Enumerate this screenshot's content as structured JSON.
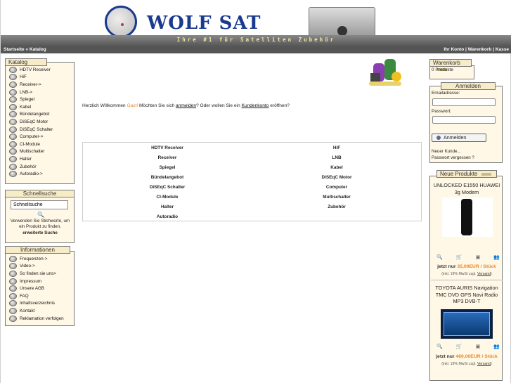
{
  "header": {
    "logo_text": "WOLF  SAT",
    "tagline": "Ihre #1 für Satelliten Zubehör"
  },
  "nav": {
    "breadcrumb": [
      "Startseite",
      "Katalog"
    ],
    "breadcrumb_sep": "»",
    "right_links": [
      "Ihr Konto",
      "Warenkorb",
      "Kasse"
    ],
    "right_sep": "|"
  },
  "catalog": {
    "title": "Katalog",
    "items": [
      "HDTV Receiver",
      "HiF",
      "Receiver->",
      "LNB->",
      "Spiegel",
      "Kabel",
      "Bündelangebot",
      "DiSEqC Motor",
      "DiSEqC Schalter",
      "Computer->",
      "CI-Module",
      "Multischalter",
      "Halter",
      "Zubehör",
      "Autoradio->"
    ]
  },
  "quicksearch": {
    "title": "Schnellsuche",
    "input_value": "Schnellsuche",
    "hint": "Verwenden Sie Stichworte, um ein Produkt zu finden.",
    "advanced": "erweiterte Suche"
  },
  "info": {
    "title": "Informationen",
    "items": [
      "Frequenzen->",
      "Video->",
      "So finden sie uns>",
      "Impressum",
      "Unsere AGB",
      "FAQ",
      "Inhaltsverzeichnis",
      "Kontakt",
      "Reklamation verfolgen"
    ]
  },
  "welcome": {
    "pre": "Herzlich Willkommen ",
    "guest": "Gast!",
    "mid": " Möchten Sie sich ",
    "login_link": "anmelden",
    "mid2": "? Oder wollen Sie ein ",
    "account_link": "Kundenkonto",
    "post": " eröffnen?"
  },
  "categories": [
    [
      "HDTV Receiver",
      "HiF"
    ],
    [
      "Receiver",
      "LNB"
    ],
    [
      "Spiegel",
      "Kabel"
    ],
    [
      "Bündelangebot",
      "DiSEqC Motor"
    ],
    [
      "DiSEqC Schalter",
      "Computer"
    ],
    [
      "CI-Module",
      "Multischalter"
    ],
    [
      "Halter",
      "Zubehör"
    ],
    [
      "Autoradio",
      ""
    ]
  ],
  "cart": {
    "title": "Warenkorb",
    "content": "0 Produkte"
  },
  "login": {
    "title": "Anmelden",
    "email_label": "Emailadresse:",
    "password_label": "Passwort:",
    "button": "Anmelden",
    "new_customer": "Neuer Kunde...",
    "forgot": "Passwort vergessen ?"
  },
  "new_products": {
    "title": "Neue Produkte",
    "items": [
      {
        "name": "UNLOCKED E1550 HUAWEI 3g Modem",
        "price_pre": "jetzt nur ",
        "price": "35,00EUR / Stück",
        "tax_pre": "(inkl. 19% MwSt zzgl. ",
        "tax_link": "Versand",
        "tax_post": ")"
      },
      {
        "name": "TOYOTA AURIS Navigation TMC DVD GPS Navi Radio MP3 DVB-T",
        "price_pre": "jetzt nur ",
        "price": "460,00EUR / Stück",
        "tax_pre": "(inkl. 19% MwSt zzgl. ",
        "tax_link": "Versand",
        "tax_post": ")"
      }
    ],
    "row_icons": [
      "zoom-icon",
      "cart-icon",
      "info-icon",
      "compare-icon"
    ]
  }
}
